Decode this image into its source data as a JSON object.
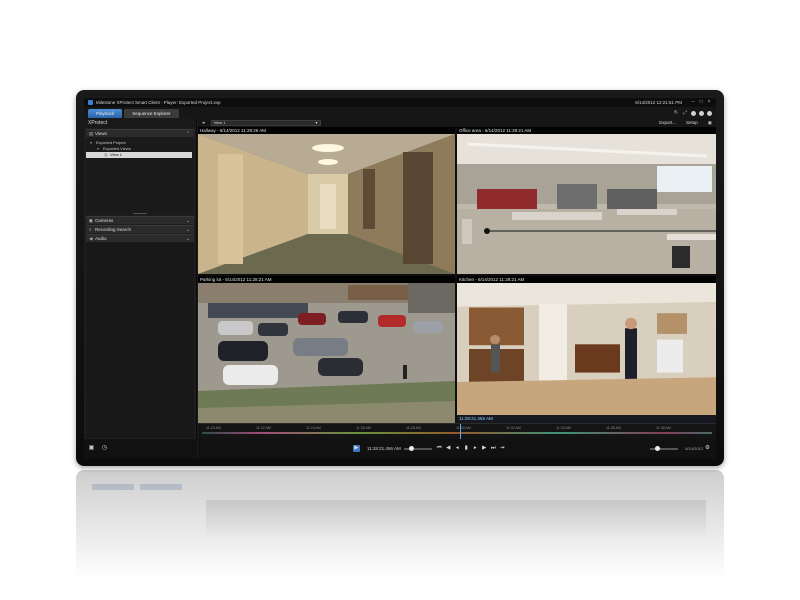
{
  "window": {
    "title": "Milestone XProtect Smart Client - Player: Exported Project.xvp",
    "clock": "6/14/2012 12:21:51 PM"
  },
  "tabs": [
    {
      "label": "Playback",
      "active": true
    },
    {
      "label": "Sequence Explorer",
      "active": false
    }
  ],
  "sidebar": {
    "header": "XProtect",
    "views_label": "Views",
    "tree": [
      {
        "label": "Exported Project",
        "indent": 1
      },
      {
        "label": "Exported Views",
        "indent": 2
      },
      {
        "label": "View 1",
        "indent": 3,
        "selected": true
      }
    ],
    "panels": [
      {
        "label": "Cameras",
        "icon": "camera-icon"
      },
      {
        "label": "Recording Search",
        "icon": "search-icon"
      },
      {
        "label": "Audio",
        "icon": "speaker-icon"
      }
    ]
  },
  "viewbar": {
    "selected_view": "View 1",
    "export_label": "Export...",
    "setup_label": "Setup"
  },
  "cameras": [
    {
      "label": "Hallway - 6/14/2012 11:28:26 AM"
    },
    {
      "label": "Office area - 6/14/2012 11:28:21 AM"
    },
    {
      "label": "Parking lot - 6/14/2012 11:28:21 AM"
    },
    {
      "label": "Kitchen - 6/14/2012 11:28:21 AM",
      "timestamp": "11:28:21.456 AM"
    }
  ],
  "timeline": {
    "ticks": [
      "11:20 AM",
      "11:22 AM",
      "11:24 AM",
      "11:26 AM",
      "11:28 AM",
      "11:30 AM",
      "11:32 AM",
      "11:34 AM",
      "11:36 AM",
      "11:38 AM"
    ]
  },
  "playback": {
    "time": "11:28:21.456 AM",
    "date": "6/14/2012"
  },
  "colors": {
    "accent": "#3b7fd0",
    "timestamp": "#8fd0ff"
  }
}
